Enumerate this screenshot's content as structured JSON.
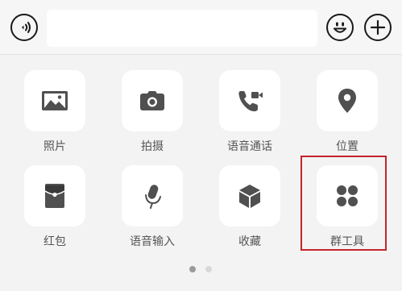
{
  "input": {
    "value": "",
    "placeholder": ""
  },
  "toolbar": {
    "voice_icon": "voice-mode-icon",
    "emoji_icon": "emoji-icon",
    "plus_icon": "plus-icon"
  },
  "panel": {
    "items": [
      {
        "label": "照片",
        "icon": "image-icon"
      },
      {
        "label": "拍摄",
        "icon": "camera-icon"
      },
      {
        "label": "语音通话",
        "icon": "phone-video-icon"
      },
      {
        "label": "位置",
        "icon": "location-pin-icon"
      },
      {
        "label": "红包",
        "icon": "red-packet-icon"
      },
      {
        "label": "语音输入",
        "icon": "microphone-icon"
      },
      {
        "label": "收藏",
        "icon": "cube-icon"
      },
      {
        "label": "群工具",
        "icon": "four-dots-icon"
      }
    ],
    "highlighted_item": "群工具",
    "highlight_color": "#c4242b"
  },
  "pager": {
    "current_page": 1,
    "total_pages": 2
  }
}
